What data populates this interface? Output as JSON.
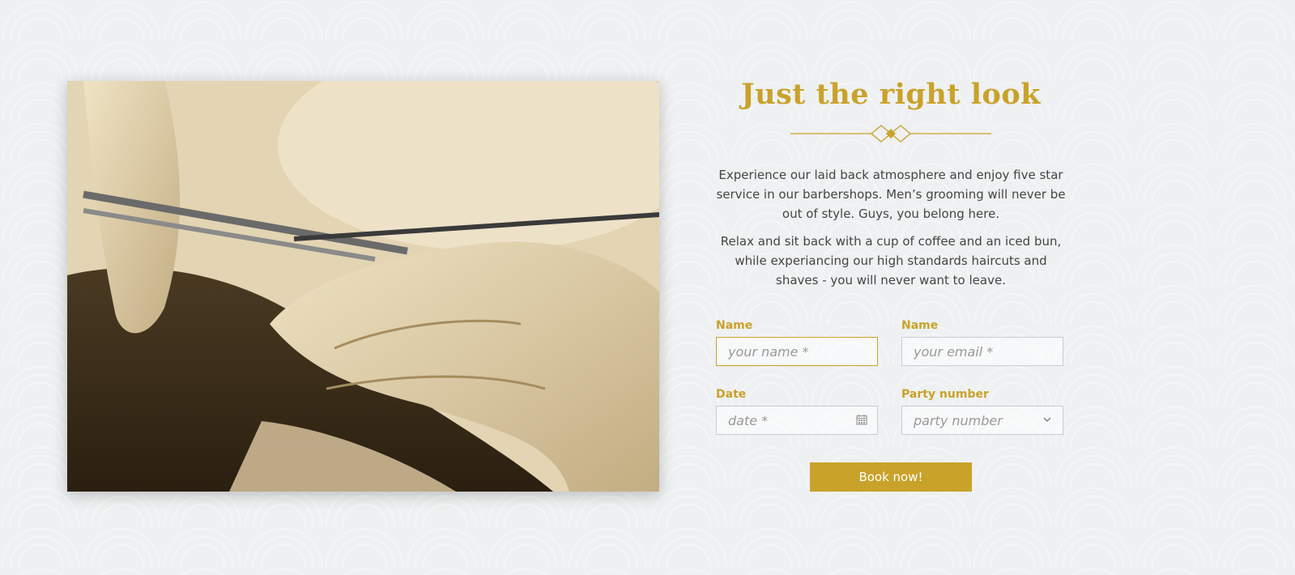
{
  "section": {
    "title": "Just the right look",
    "paragraphs": [
      "Experience our laid back atmosphere and enjoy five star service in our barbershops. Men’s grooming will never be out of style. Guys, you belong here.",
      "Relax and sit back with a cup of coffee and an iced bun, while experiancing our high standards haircuts and shaves - you will never want to leave."
    ]
  },
  "form": {
    "name": {
      "label": "Name",
      "placeholder": "your name *"
    },
    "email": {
      "label": "Name",
      "placeholder": "your email *"
    },
    "date": {
      "label": "Date",
      "placeholder": "date *"
    },
    "party": {
      "label": "Party number",
      "placeholder": "party number"
    },
    "submit_label": "Book now!"
  },
  "colors": {
    "accent": "#c9a22a",
    "text": "#444444"
  },
  "image": {
    "subject": "barber cutting hair with scissors and comb (sepia photo)"
  }
}
